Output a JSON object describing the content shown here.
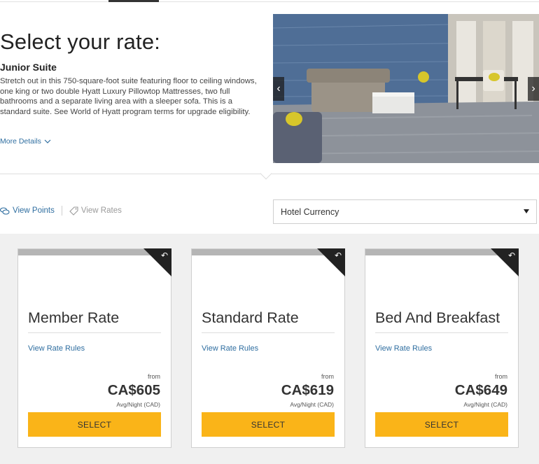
{
  "header": {
    "page_title": "Select your rate:"
  },
  "room": {
    "name": "Junior Suite",
    "description": "Stretch out in this 750-square-foot suite featuring floor to ceiling windows, one king or two double Hyatt Luxury Pillowtop Mattresses, two full bathrooms and a separate living area with a sleeper sofa. This is a standard suite. See World of Hyatt program terms for upgrade eligibility.",
    "more_details": "More Details",
    "photo_icon": "room-photo",
    "prev_icon": "chevron-left-icon",
    "next_icon": "chevron-right-icon"
  },
  "view_toggle": {
    "points_label": "View Points",
    "rates_label": "View Rates",
    "points_icon": "points-icon",
    "rates_icon": "tag-icon"
  },
  "currency": {
    "selected": "Hotel Currency"
  },
  "rates": [
    {
      "name": "Member Rate",
      "rules": "View Rate Rules",
      "from": "from",
      "price": "CA$605",
      "avg": "Avg/Night (CAD)",
      "select": "SELECT"
    },
    {
      "name": "Standard Rate",
      "rules": "View Rate Rules",
      "from": "from",
      "price": "CA$619",
      "avg": "Avg/Night (CAD)",
      "select": "SELECT"
    },
    {
      "name": "Bed And Breakfast",
      "rules": "View Rate Rules",
      "from": "from",
      "price": "CA$649",
      "avg": "Avg/Night (CAD)",
      "select": "SELECT"
    }
  ],
  "colors": {
    "accent_link": "#2f6ea0",
    "select_button": "#fab418",
    "card_corner": "#222222",
    "rates_background": "#f0f0f0"
  }
}
